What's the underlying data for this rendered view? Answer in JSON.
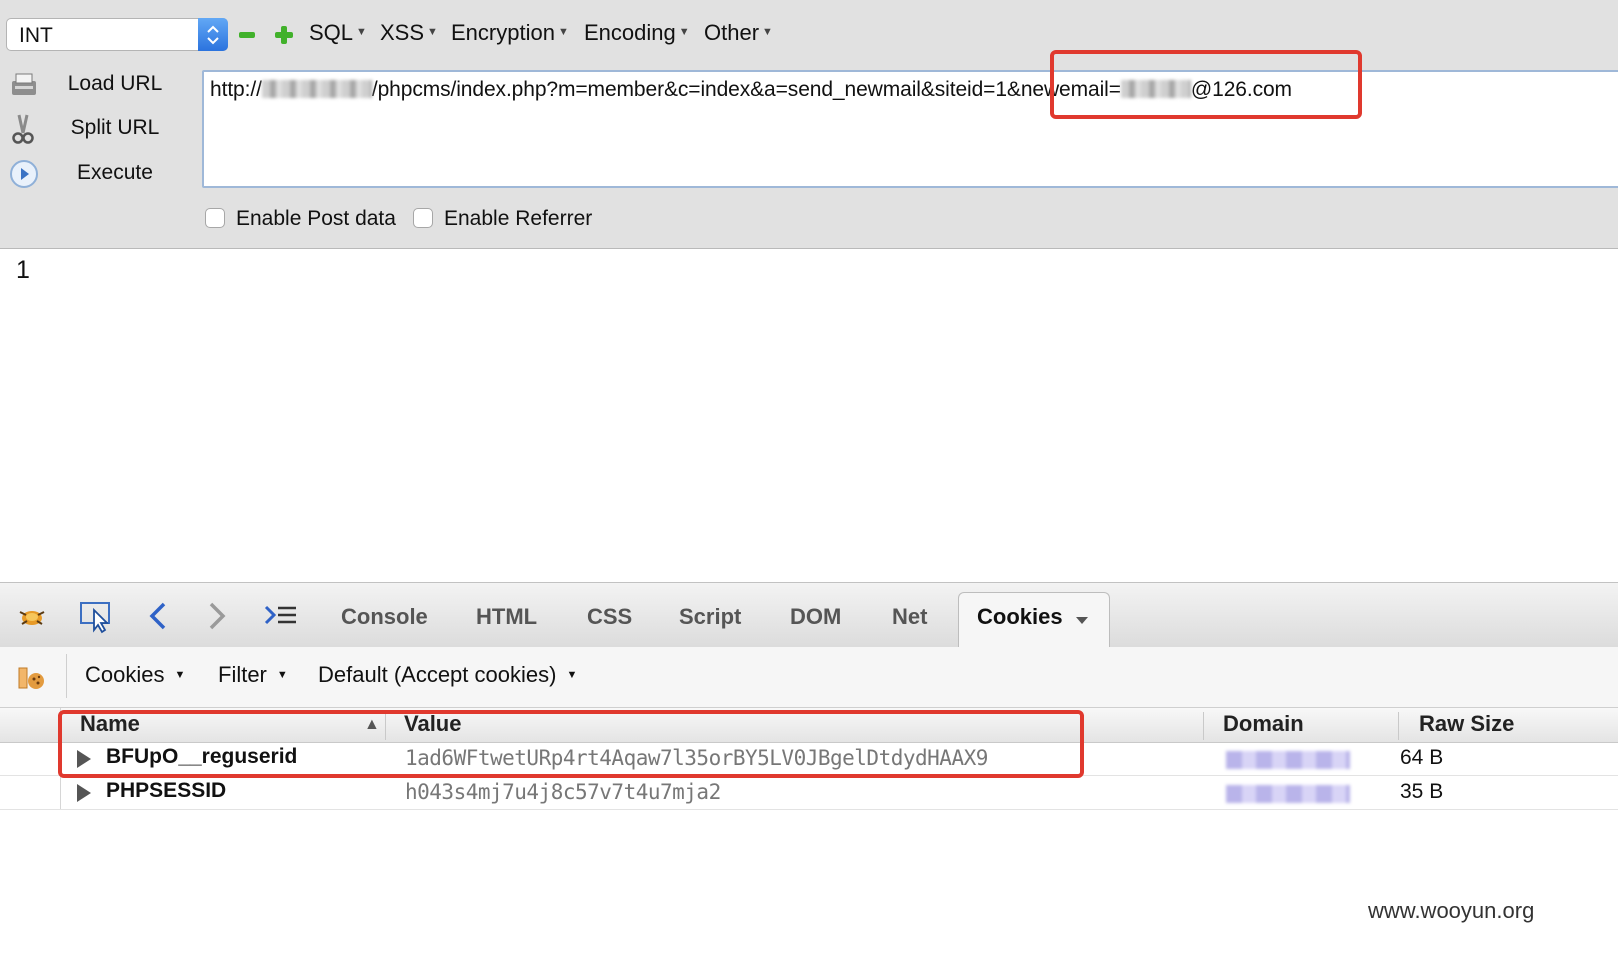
{
  "hackbar": {
    "type_select": "INT",
    "menus": [
      {
        "label": "SQL"
      },
      {
        "label": "XSS"
      },
      {
        "label": "Encryption"
      },
      {
        "label": "Encoding"
      },
      {
        "label": "Other"
      }
    ],
    "side_buttons": {
      "load": "Load URL",
      "split": "Split URL",
      "execute": "Execute"
    },
    "url": {
      "prefix": "http://",
      "path": "/phpcms/index.php?m=member&c=index&a=send_newmail&siteid=1&newemail=",
      "suffix": "@126.com"
    },
    "checkboxes": {
      "post": "Enable Post data",
      "referrer": "Enable Referrer"
    }
  },
  "result": "1",
  "firebug": {
    "tabs": [
      "Console",
      "HTML",
      "CSS",
      "Script",
      "DOM",
      "Net"
    ],
    "active_tab": "Cookies",
    "toolbar": {
      "cookies": "Cookies",
      "filter": "Filter",
      "policy": "Default (Accept cookies)"
    },
    "columns": {
      "name": "Name",
      "sort_arrow": "▲",
      "value": "Value",
      "domain": "Domain",
      "raw_size": "Raw Size"
    },
    "rows": [
      {
        "name": "BFUpO__reguserid",
        "value": "1ad6WFtwetURp4rt4Aqaw7l35orBY5LV0JBgelDtdydHAAX9",
        "raw_size": "64 B"
      },
      {
        "name": "PHPSESSID",
        "value": "h043s4mj7u4j8c57v7t4u7mja2",
        "raw_size": "35 B"
      }
    ]
  },
  "watermark": "www.wooyun.org",
  "colors": {
    "highlight_red": "#e0392e",
    "select_blue": "#2b73de",
    "tab_blue": "#2f62c7"
  }
}
